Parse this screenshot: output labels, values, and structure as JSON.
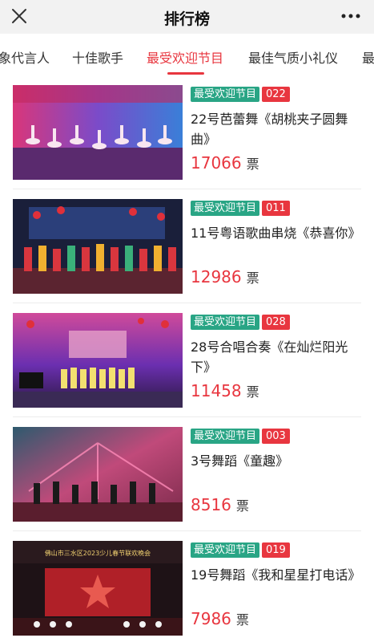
{
  "header": {
    "title": "排行榜",
    "close_icon": "close-icon",
    "more_icon": "more-dots-icon"
  },
  "tabs": [
    {
      "label": "象代言人"
    },
    {
      "label": "十佳歌手"
    },
    {
      "label": "最受欢迎节目",
      "active": true
    },
    {
      "label": "最佳气质小礼仪"
    },
    {
      "label": "最"
    }
  ],
  "colors": {
    "accent": "#e8363f",
    "badge_green": "#29a585"
  },
  "items": [
    {
      "category": "最受欢迎节目",
      "number": "022",
      "title": "22号芭蕾舞《胡桃夹子圆舞曲》",
      "votes": "17066",
      "unit": "票"
    },
    {
      "category": "最受欢迎节目",
      "number": "011",
      "title": "11号粤语歌曲串烧《恭喜你》",
      "votes": "12986",
      "unit": "票"
    },
    {
      "category": "最受欢迎节目",
      "number": "028",
      "title": "28号合唱合奏《在灿烂阳光下》",
      "votes": "11458",
      "unit": "票"
    },
    {
      "category": "最受欢迎节目",
      "number": "003",
      "title": "3号舞蹈《童趣》",
      "votes": "8516",
      "unit": "票"
    },
    {
      "category": "最受欢迎节目",
      "number": "019",
      "title": "19号舞蹈《我和星星打电话》",
      "votes": "7986",
      "unit": "票"
    }
  ],
  "photo_banner_text": "佛山市三水区2023少儿春节联欢晚会"
}
